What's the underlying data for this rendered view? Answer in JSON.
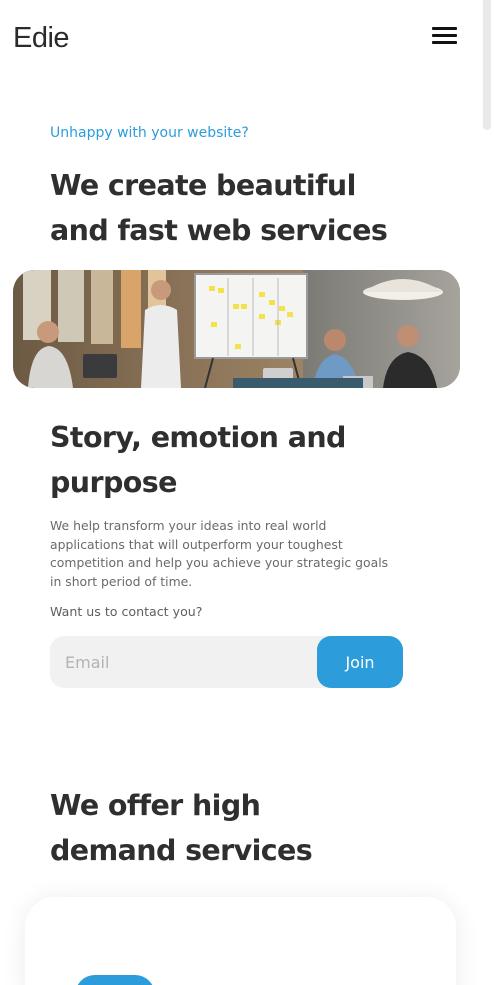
{
  "header": {
    "brand": "Edie",
    "menu_icon": "hamburger-menu-icon"
  },
  "hero": {
    "eyebrow": "Unhappy with your website?",
    "title": "We create beautiful and fast web services",
    "image_description_icon": "team-meeting-photo"
  },
  "story": {
    "title": "Story, emotion and purpose",
    "text": "We help transform your ideas into real world applications that will outperform your toughest competition and help you achieve your strategic goals in short period of time.",
    "contact_prompt": "Want us to contact you?"
  },
  "signup": {
    "email_placeholder": "Email",
    "join_label": "Join"
  },
  "services": {
    "title": "We offer high demand services"
  },
  "colors": {
    "accent": "#2d9cdb",
    "heading": "#2f2f2f",
    "body_text": "#6a6a6a",
    "input_bg": "#f1f1f1"
  }
}
